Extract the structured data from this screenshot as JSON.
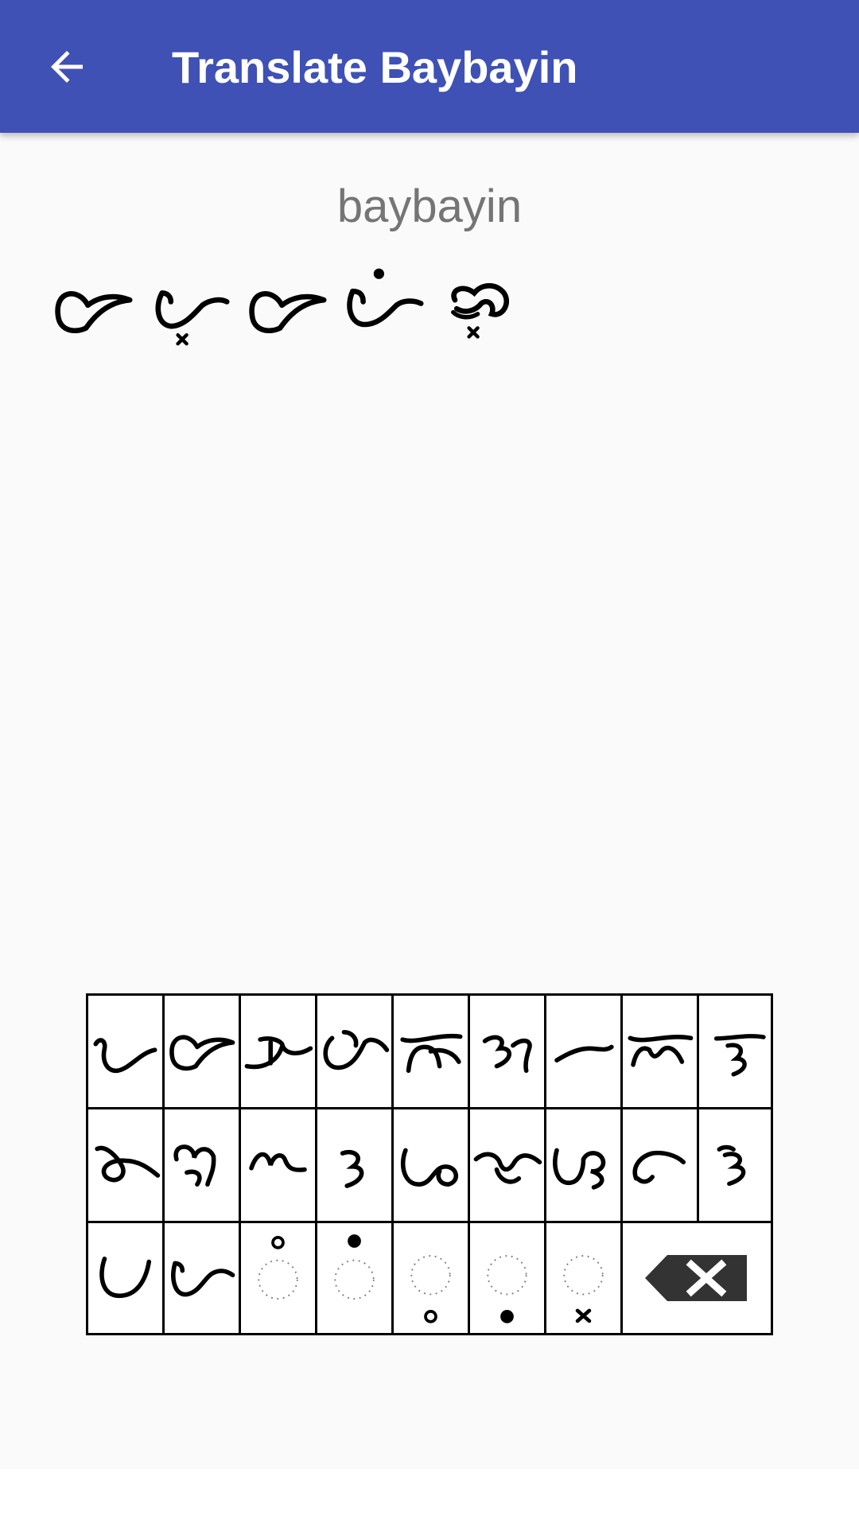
{
  "appbar": {
    "title": "Translate Baybayin",
    "color": "#3f51b5",
    "back_icon": "arrow-back-icon"
  },
  "output": {
    "latin_text": "baybayin",
    "glyphs": [
      "ba",
      "bay",
      "ba",
      "yi",
      "nu"
    ]
  },
  "keyboard": {
    "rows": [
      [
        "a",
        "ba",
        "ka",
        "da",
        "ga",
        "ha",
        "la",
        "ma",
        "na"
      ],
      [
        "nga",
        "pa",
        "ra",
        "sa",
        "ta",
        "wa",
        "ya",
        "e_i",
        "o_u"
      ],
      [
        "o_u_alt",
        "a_alt",
        "kudlit-o-circle-top",
        "kudlit-dot-top",
        "kudlit-o-circle-bottom",
        "kudlit-dot-bottom",
        "virama-x-bottom",
        "backspace"
      ]
    ]
  }
}
